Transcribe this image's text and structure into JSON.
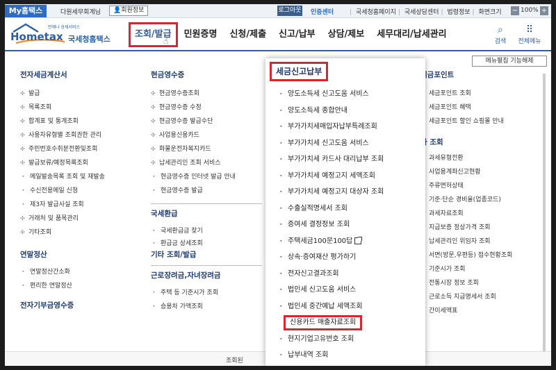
{
  "topbar": {
    "my_hometax": "My홈택스",
    "user_label": "다원세무회계님",
    "member_info": "회원정보",
    "logout": "로그아웃",
    "cert_center": "인증센터",
    "links": [
      "국세청홈페이지",
      "국세상담센터",
      "법령정보",
      "화면크기"
    ],
    "zoom_minus": "−",
    "zoom_value": "100%",
    "zoom_plus": "+"
  },
  "header": {
    "logo_text": "Hometax",
    "logo_tagline": "언제나 상세서비스",
    "logo_ko": "국세청홈택스",
    "nav": [
      "조회/발급",
      "민원증명",
      "신청/제출",
      "신고/납부",
      "상담/제보",
      "세무대리/납세관리"
    ],
    "search_label": "검색",
    "all_menu_label": "전체메뉴"
  },
  "mega": {
    "menu_settings": "메뉴펼침 기능해제",
    "col1": {
      "title": "전자세금계산서",
      "items": [
        {
          "text": "발급",
          "sub": false
        },
        {
          "text": "목록조회",
          "sub": false
        },
        {
          "text": "합계표 및 통계조회",
          "sub": false
        },
        {
          "text": "사용자유형별 조회권한 관리",
          "sub": false
        },
        {
          "text": "주민번호수취분전환및조회",
          "sub": false
        },
        {
          "text": "발급보류/예정목록조회",
          "sub": false
        },
        {
          "text": "메일발송목록 조회 및 재발송",
          "sub": true
        },
        {
          "text": "수신전용메일 신청",
          "sub": true
        },
        {
          "text": "제3자 발급사실 조회",
          "sub": true
        },
        {
          "text": "거래처 및 품목관리",
          "sub": false
        },
        {
          "text": "기타조회",
          "sub": false
        }
      ],
      "section2_title": "연말정산",
      "section2_items": [
        "연말정산간소화",
        "편리한 연말정산"
      ],
      "section3_title": "전자기부금영수증"
    },
    "col2": {
      "title": "현금영수증",
      "items": [
        {
          "text": "현금영수증조회",
          "sub": false
        },
        {
          "text": "현금영수증 수정",
          "sub": false
        },
        {
          "text": "현금영수증 발급수단",
          "sub": false
        },
        {
          "text": "사업용신용카드",
          "sub": false
        },
        {
          "text": "화물운전자복지카드",
          "sub": false
        },
        {
          "text": "납세관리인 조회 서비스",
          "sub": false
        },
        {
          "text": "현금영수증 인터넷 발급 안내",
          "sub": true
        },
        {
          "text": "현금영수증 발급",
          "sub": true
        }
      ],
      "section2_title": "국세환급",
      "section2_items": [
        "국세환급금 찾기",
        "환급금 상세조회"
      ],
      "section3_title": "기타 조회/발급",
      "section4_title": "근로장려금,자녀장려금",
      "section4_items": [
        "주택 등 기준시가 조회",
        "승용차 가액조회"
      ]
    },
    "col4": {
      "title": "세금포인트",
      "items": [
        "세금포인트 조회",
        "세금포인트 혜택",
        "세금포인트 할인 쇼핑몰 안내"
      ],
      "section2_title": "타 조회",
      "section2_items": [
        "과세유형전환",
        "사업용계좌신고현황",
        "주류면허상태",
        "기준·단순 경비율(업종코드)",
        "과세자료조회",
        "지급보증 정상가격 조회",
        "납세관리인 위임자 조회",
        "서면(방문,우편등) 접수현황조회",
        "기준시가 조회",
        "전통시장 정보 조회",
        "근로소득 지급명세서 조회",
        "간이세액표"
      ]
    },
    "overlay": {
      "title": "세금신고납부",
      "items": [
        "양도소득세 신고도움 서비스",
        "양도소득세 종합안내",
        "부가가치세매입자납부특례조회",
        "부가가치세 신고도움 서비스",
        "부가가치세 카드사 대리납부 조회",
        "부가가치세 예정고지 세액조회",
        "부가가치세 예정고지 대상자 조회",
        "수출실적명세서 조회",
        "증여세 결정정보 조회",
        "주택세금100문100답",
        "상속·증여재산 평가하기",
        "전자신고결과조회",
        "법인세 신고도움 서비스",
        "법인세 중간예납 세액조회",
        "신용카드 매출자료조회",
        "현지기업고유번호 조회",
        "납부내역 조회"
      ]
    },
    "footer_text": "조회된"
  }
}
